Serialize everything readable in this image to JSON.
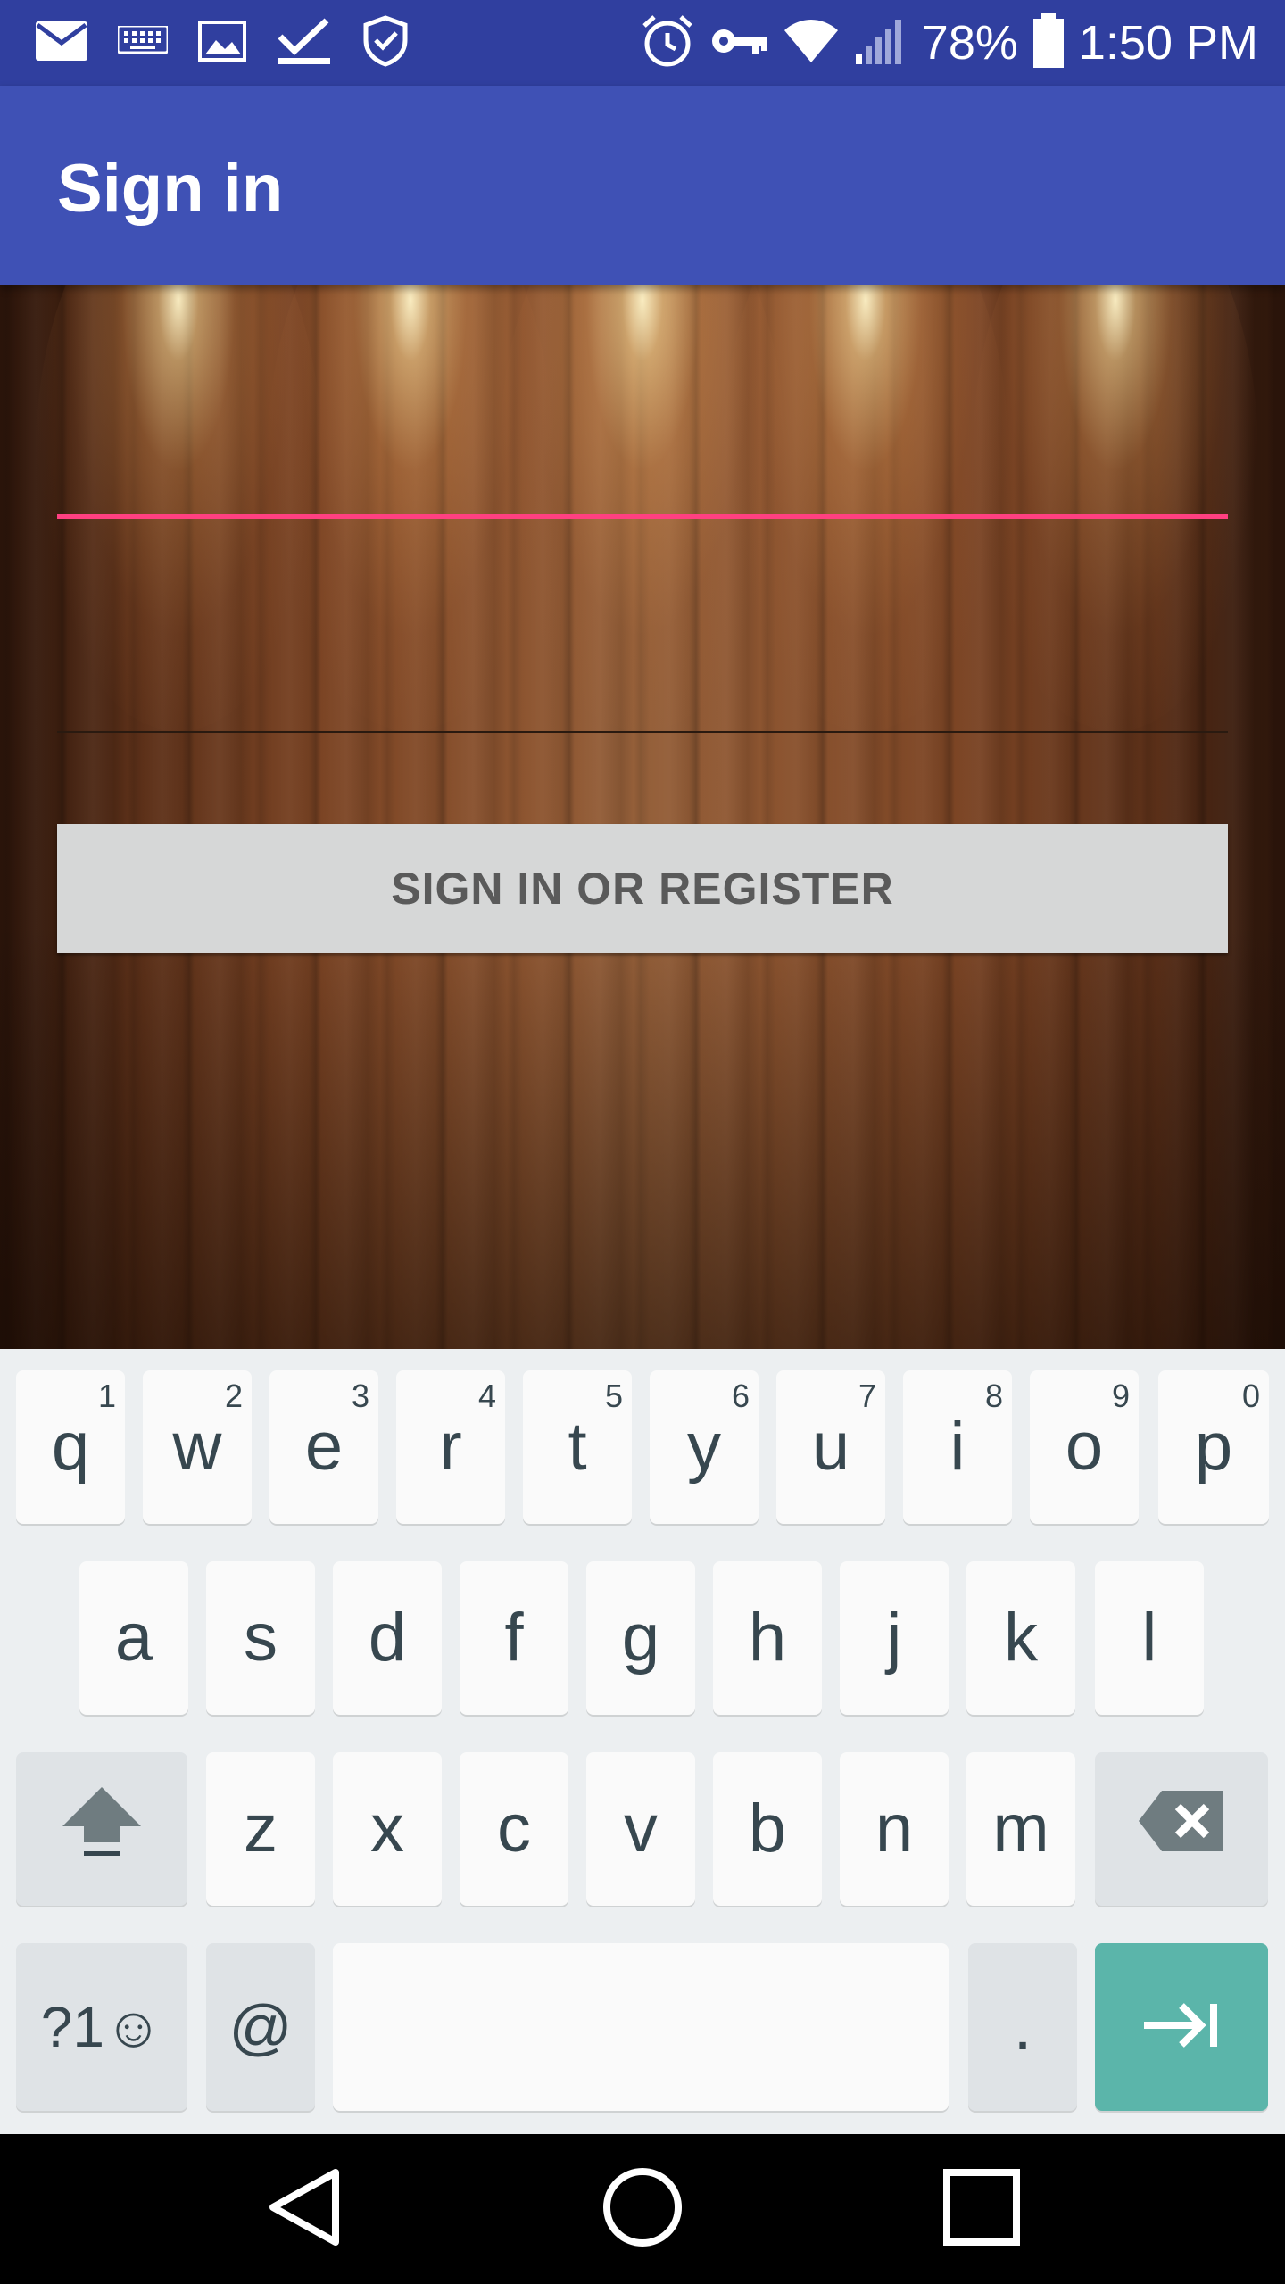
{
  "status_bar": {
    "left_icons": [
      "mail-icon",
      "keyboard-icon",
      "image-icon",
      "download-done-icon",
      "shield-icon"
    ],
    "right_icons": [
      "alarm-icon",
      "vpn-key-icon",
      "wifi-icon",
      "signal-icon",
      "battery-icon"
    ],
    "battery_percent": "78%",
    "battery_level": 0.78,
    "time": "1:50 PM"
  },
  "app_bar": {
    "title": "Sign in"
  },
  "form": {
    "field1_value": "",
    "field2_value": "",
    "sign_in_button": "SIGN IN OR REGISTER",
    "accent_color": "#FF4081"
  },
  "keyboard": {
    "row1": [
      {
        "label": "q",
        "hint": "1"
      },
      {
        "label": "w",
        "hint": "2"
      },
      {
        "label": "e",
        "hint": "3"
      },
      {
        "label": "r",
        "hint": "4"
      },
      {
        "label": "t",
        "hint": "5"
      },
      {
        "label": "y",
        "hint": "6"
      },
      {
        "label": "u",
        "hint": "7"
      },
      {
        "label": "i",
        "hint": "8"
      },
      {
        "label": "o",
        "hint": "9"
      },
      {
        "label": "p",
        "hint": "0"
      }
    ],
    "row2": [
      "a",
      "s",
      "d",
      "f",
      "g",
      "h",
      "j",
      "k",
      "l"
    ],
    "row3": [
      "z",
      "x",
      "c",
      "v",
      "b",
      "n",
      "m"
    ],
    "symbols_label": "?1☺",
    "at_label": "@",
    "period_label": ".",
    "shift_icon": "shift-icon",
    "backspace_icon": "backspace-icon",
    "enter_icon": "tab-next-icon",
    "enter_color": "#5BB5AA"
  },
  "nav_bar": {
    "icons": [
      "back-icon",
      "home-icon",
      "recents-icon"
    ]
  },
  "colors": {
    "status_bar": "#303F9F",
    "app_bar": "#3F51B5",
    "button_bg": "#D6D7D7"
  }
}
